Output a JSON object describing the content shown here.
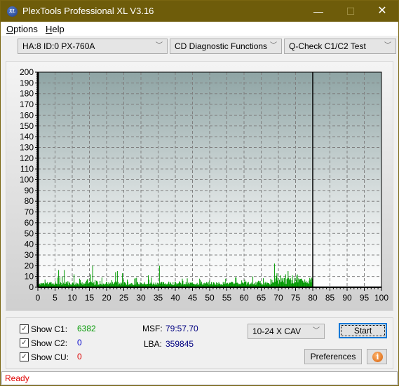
{
  "window": {
    "title": "PlexTools Professional XL V3.16",
    "app_icon_text": "XL",
    "controls": {
      "minimize": "—",
      "maximize": "☐",
      "close": "✕"
    }
  },
  "menu": {
    "items": [
      {
        "label": "Options",
        "mnemonic": "O"
      },
      {
        "label": "Help",
        "mnemonic": "H"
      }
    ]
  },
  "toolbar": {
    "drive_select": "HA:8 ID:0  PX-760A",
    "function_select": "CD Diagnostic Functions",
    "test_select": "Q-Check C1/C2 Test",
    "dropdown_arrow": "﹀"
  },
  "chart_data": {
    "type": "bar",
    "title": "",
    "xlabel": "",
    "ylabel": "",
    "xlim": [
      0,
      100
    ],
    "ylim": [
      0,
      200
    ],
    "x_ticks": [
      0,
      5,
      10,
      15,
      20,
      25,
      30,
      35,
      40,
      45,
      50,
      55,
      60,
      65,
      70,
      75,
      80,
      85,
      90,
      95,
      100
    ],
    "y_ticks": [
      0,
      10,
      20,
      30,
      40,
      50,
      60,
      70,
      80,
      90,
      100,
      110,
      120,
      130,
      140,
      150,
      160,
      170,
      180,
      190,
      200
    ],
    "grid": true,
    "end_marker_x": 80,
    "colors": {
      "c1": "#009900",
      "c2": "#0000cc",
      "cu": "#dd0000"
    },
    "series": [
      {
        "name": "C1",
        "x_start": 0,
        "x_end": 80,
        "peaks": [
          {
            "x": 1.0,
            "y": 4
          },
          {
            "x": 2.0,
            "y": 7
          },
          {
            "x": 3.5,
            "y": 4
          },
          {
            "x": 5.5,
            "y": 9
          },
          {
            "x": 6.0,
            "y": 16
          },
          {
            "x": 7.0,
            "y": 10
          },
          {
            "x": 7.5,
            "y": 16
          },
          {
            "x": 9.0,
            "y": 5
          },
          {
            "x": 10.5,
            "y": 12
          },
          {
            "x": 12.0,
            "y": 8
          },
          {
            "x": 14.0,
            "y": 6
          },
          {
            "x": 15.3,
            "y": 12
          },
          {
            "x": 15.8,
            "y": 20
          },
          {
            "x": 17.0,
            "y": 6
          },
          {
            "x": 18.5,
            "y": 9
          },
          {
            "x": 20.0,
            "y": 5
          },
          {
            "x": 22.5,
            "y": 14
          },
          {
            "x": 23.0,
            "y": 15
          },
          {
            "x": 24.5,
            "y": 13
          },
          {
            "x": 26.0,
            "y": 5
          },
          {
            "x": 28.0,
            "y": 8
          },
          {
            "x": 30.0,
            "y": 4
          },
          {
            "x": 32.0,
            "y": 11
          },
          {
            "x": 33.0,
            "y": 9
          },
          {
            "x": 35.3,
            "y": 20
          },
          {
            "x": 38.0,
            "y": 4
          },
          {
            "x": 40.0,
            "y": 5
          },
          {
            "x": 42.0,
            "y": 8
          },
          {
            "x": 44.5,
            "y": 4
          },
          {
            "x": 47.0,
            "y": 8
          },
          {
            "x": 50.0,
            "y": 3
          },
          {
            "x": 54.5,
            "y": 8
          },
          {
            "x": 57.5,
            "y": 9
          },
          {
            "x": 60.0,
            "y": 5
          },
          {
            "x": 62.5,
            "y": 10
          },
          {
            "x": 64.0,
            "y": 6
          },
          {
            "x": 66.0,
            "y": 5
          },
          {
            "x": 68.8,
            "y": 22
          },
          {
            "x": 69.5,
            "y": 13
          },
          {
            "x": 70.5,
            "y": 11
          },
          {
            "x": 72.0,
            "y": 12
          },
          {
            "x": 72.8,
            "y": 15
          },
          {
            "x": 74.0,
            "y": 11
          },
          {
            "x": 76.0,
            "y": 7
          },
          {
            "x": 78.0,
            "y": 6
          },
          {
            "x": 79.7,
            "y": 8
          }
        ],
        "baseline": 2
      }
    ]
  },
  "stats": {
    "show_c1_label": "Show C1:",
    "show_c2_label": "Show C2:",
    "show_cu_label": "Show CU:",
    "show_c1_checked": true,
    "show_c2_checked": true,
    "show_cu_checked": true,
    "c1_value": "6382",
    "c2_value": "0",
    "cu_value": "0",
    "msf_label": "MSF:",
    "msf_value": "79:57.70",
    "lba_label": "LBA:",
    "lba_value": "359845",
    "checkmark": "✓"
  },
  "controls": {
    "speed_select": "10-24 X CAV",
    "start_button": "Start",
    "preferences_button": "Preferences",
    "info_icon_glyph": "i"
  },
  "status": {
    "text": "Ready"
  }
}
